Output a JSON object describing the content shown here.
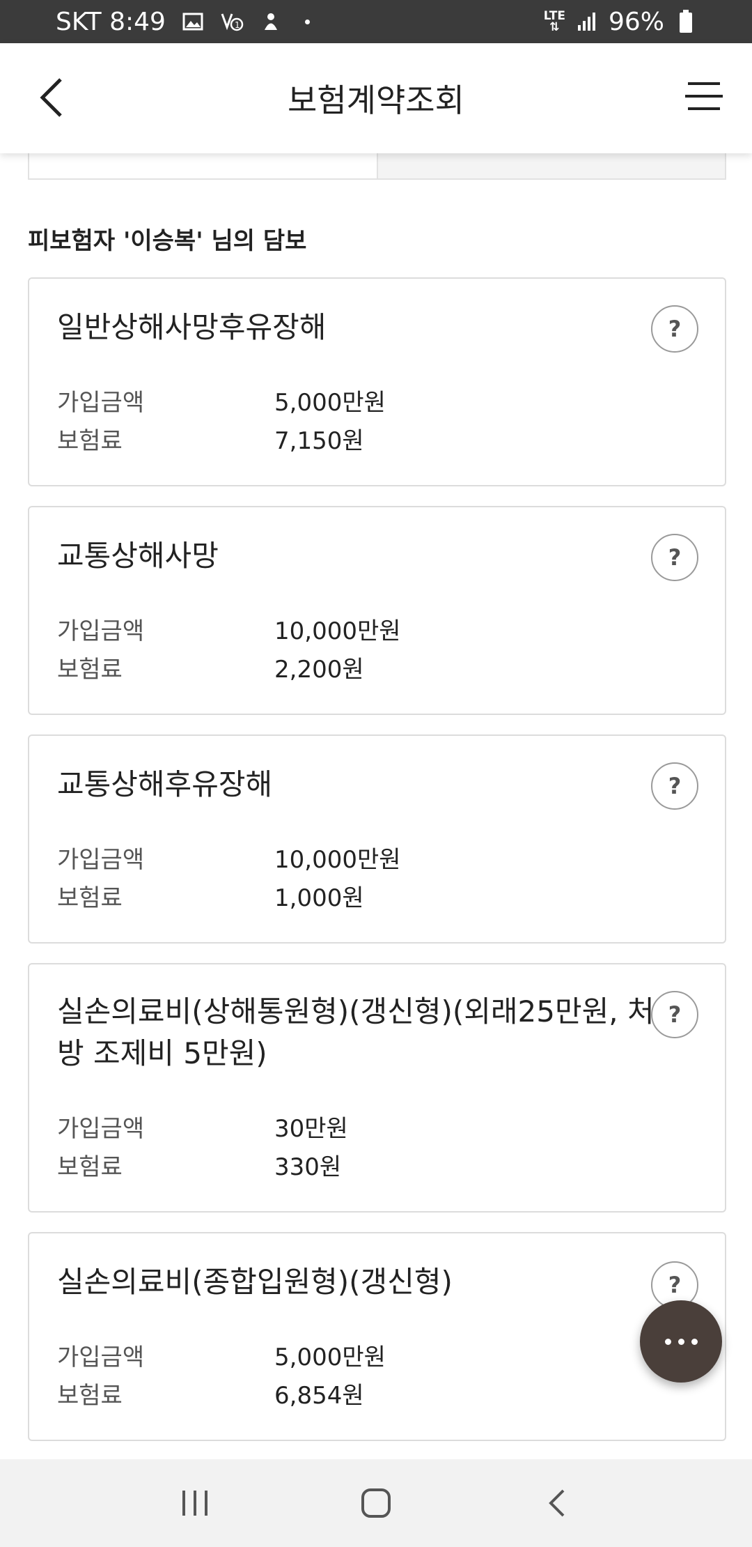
{
  "status_bar": {
    "carrier_time": "SKT 8:49",
    "network": "LTE",
    "battery": "96%",
    "icons": [
      "gallery-icon",
      "volte-icon",
      "notification-icon",
      "dot-icon",
      "signal-icon",
      "battery-icon"
    ]
  },
  "app_bar": {
    "title": "보험계약조회"
  },
  "section": {
    "heading": "피보험자 '이승복' 님의 담보"
  },
  "labels": {
    "coverage_amount": "가입금액",
    "premium": "보험료",
    "help": "?"
  },
  "coverages": [
    {
      "title": "일반상해사망후유장해",
      "amount": "5,000만원",
      "premium": "7,150원"
    },
    {
      "title": "교통상해사망",
      "amount": "10,000만원",
      "premium": "2,200원"
    },
    {
      "title": "교통상해후유장해",
      "amount": "10,000만원",
      "premium": "1,000원"
    },
    {
      "title": "실손의료비(상해통원형)(갱신형)(외래25만원, 처방 조제비 5만원)",
      "amount": "30만원",
      "premium": "330원"
    },
    {
      "title": "실손의료비(종합입원형)(갱신형)",
      "amount": "5,000만원",
      "premium": "6,854원"
    }
  ],
  "colors": {
    "status_bar": "#3b3b3b",
    "accent": "#e0782a",
    "fab": "#4a3f3a",
    "card_border": "#dcdcdc",
    "nav_bar": "#f2f2f2"
  }
}
